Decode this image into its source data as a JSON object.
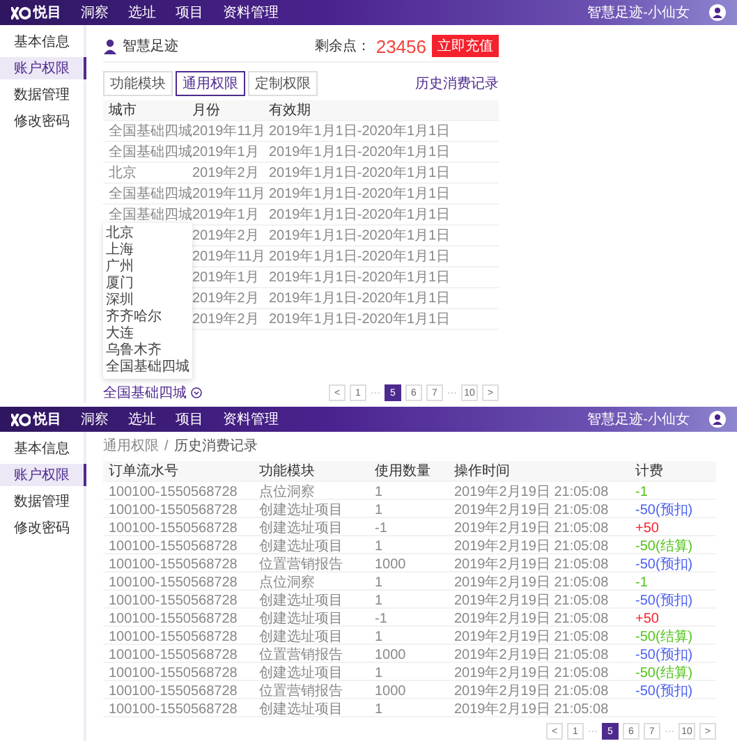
{
  "permissions_screen": {
    "header": {
      "logo": "悦目",
      "nav": [
        "洞察",
        "选址",
        "项目",
        "资料管理"
      ],
      "user": "智慧足迹-小仙女"
    },
    "sidebar": [
      {
        "label": "基本信息",
        "selected": false
      },
      {
        "label": "账户权限",
        "selected": true
      },
      {
        "label": "数据管理",
        "selected": false
      },
      {
        "label": "修改密码",
        "selected": false
      }
    ],
    "profile": {
      "name": "智慧足迹",
      "points_label": "剩余点：",
      "points": "23456",
      "recharge_button": "立即充值"
    },
    "tabs": [
      {
        "label": "功能模块",
        "selected": false
      },
      {
        "label": "通用权限",
        "selected": true
      },
      {
        "label": "定制权限",
        "selected": false
      }
    ],
    "history_link": "历史消费记录",
    "table": {
      "columns": [
        "城市",
        "月份",
        "有效期"
      ],
      "rows": [
        {
          "city": "全国基础四城",
          "month": "2019年11月",
          "validity": "2019年1月1日-2020年1月1日"
        },
        {
          "city": "全国基础四城",
          "month": "2019年1月",
          "validity": "2019年1月1日-2020年1月1日"
        },
        {
          "city": "北京",
          "month": "2019年2月",
          "validity": "2019年1月1日-2020年1月1日"
        },
        {
          "city": "全国基础四城",
          "month": "2019年11月",
          "validity": "2019年1月1日-2020年1月1日"
        },
        {
          "city": "全国基础四城",
          "month": "2019年1月",
          "validity": "2019年1月1日-2020年1月1日"
        },
        {
          "month": "2019年2月",
          "validity": "2019年1月1日-2020年1月1日"
        },
        {
          "month": "2019年11月",
          "validity": "2019年1月1日-2020年1月1日"
        },
        {
          "month": "2019年1月",
          "validity": "2019年1月1日-2020年1月1日"
        },
        {
          "month": "2019年2月",
          "validity": "2019年1月1日-2020年1月1日"
        },
        {
          "month": "2019年2月",
          "validity": "2019年1月1日-2020年1月1日"
        }
      ]
    },
    "city_select": {
      "value": "全国基础四城",
      "expanded": true,
      "options": [
        "北京",
        "上海",
        "广州",
        "厦门",
        "深圳",
        "齐齐哈尔",
        "大连",
        "乌鲁木齐",
        "全国基础四城"
      ]
    },
    "pagination": [
      {
        "label": "<",
        "kind": "page",
        "selected": false
      },
      {
        "label": "1",
        "kind": "page",
        "selected": false
      },
      {
        "label": "···",
        "kind": "ellipsis",
        "selected": false
      },
      {
        "label": "5",
        "kind": "page",
        "selected": true
      },
      {
        "label": "6",
        "kind": "page",
        "selected": false
      },
      {
        "label": "7",
        "kind": "page",
        "selected": false
      },
      {
        "label": "···",
        "kind": "ellipsis",
        "selected": false
      },
      {
        "label": "10",
        "kind": "page",
        "selected": false
      },
      {
        "label": ">",
        "kind": "page",
        "selected": false
      }
    ]
  },
  "history_screen": {
    "header": {
      "logo": "悦目",
      "nav": [
        "洞察",
        "选址",
        "项目",
        "资料管理"
      ],
      "user": "智慧足迹-小仙女"
    },
    "sidebar": [
      {
        "label": "基本信息",
        "selected": false
      },
      {
        "label": "账户权限",
        "selected": true
      },
      {
        "label": "数据管理",
        "selected": false
      },
      {
        "label": "修改密码",
        "selected": false
      }
    ],
    "breadcrumb": [
      "通用权限",
      "/",
      "历史消费记录"
    ],
    "table": {
      "columns": [
        "订单流水号",
        "功能模块",
        "使用数量",
        "操作时间",
        "计费"
      ],
      "rows": [
        {
          "order": "100100-1550568728",
          "module": "点位洞察",
          "quantity": "1",
          "time": "2019年2月19日 21:05:08",
          "fee": "-1",
          "color": "#52c41a"
        },
        {
          "order": "100100-1550568728",
          "module": "创建选址项目",
          "quantity": "1",
          "time": "2019年2月19日 21:05:08",
          "fee": "-50(预扣)",
          "color": "#4a5ff0"
        },
        {
          "order": "100100-1550568728",
          "module": "创建选址项目",
          "quantity": "-1",
          "time": "2019年2月19日 21:05:08",
          "fee": "+50",
          "color": "#f5222d"
        },
        {
          "order": "100100-1550568728",
          "module": "创建选址项目",
          "quantity": "1",
          "time": "2019年2月19日 21:05:08",
          "fee": "-50(结算)",
          "color": "#52c41a"
        },
        {
          "order": "100100-1550568728",
          "module": "位置营销报告",
          "quantity": "1000",
          "time": "2019年2月19日 21:05:08",
          "fee": "-50(预扣)",
          "color": "#4a5ff0"
        },
        {
          "order": "100100-1550568728",
          "module": "点位洞察",
          "quantity": "1",
          "time": "2019年2月19日 21:05:08",
          "fee": "-1",
          "color": "#52c41a"
        },
        {
          "order": "100100-1550568728",
          "module": "创建选址项目",
          "quantity": "1",
          "time": "2019年2月19日 21:05:08",
          "fee": "-50(预扣)",
          "color": "#4a5ff0"
        },
        {
          "order": "100100-1550568728",
          "module": "创建选址项目",
          "quantity": "-1",
          "time": "2019年2月19日 21:05:08",
          "fee": "+50",
          "color": "#f5222d"
        },
        {
          "order": "100100-1550568728",
          "module": "创建选址项目",
          "quantity": "1",
          "time": "2019年2月19日 21:05:08",
          "fee": "-50(结算)",
          "color": "#52c41a"
        },
        {
          "order": "100100-1550568728",
          "module": "位置营销报告",
          "quantity": "1000",
          "time": "2019年2月19日 21:05:08",
          "fee": "-50(预扣)",
          "color": "#4a5ff0"
        },
        {
          "order": "100100-1550568728",
          "module": "创建选址项目",
          "quantity": "1",
          "time": "2019年2月19日 21:05:08",
          "fee": "-50(结算)",
          "color": "#52c41a"
        },
        {
          "order": "100100-1550568728",
          "module": "位置营销报告",
          "quantity": "1000",
          "time": "2019年2月19日 21:05:08",
          "fee": "-50(预扣)",
          "color": "#4a5ff0"
        },
        {
          "order": "100100-1550568728",
          "module": "创建选址项目",
          "quantity": "1",
          "time": "2019年2月19日 21:05:08"
        }
      ]
    },
    "pagination": [
      {
        "label": "<",
        "kind": "page",
        "selected": false
      },
      {
        "label": "1",
        "kind": "page",
        "selected": false
      },
      {
        "label": "···",
        "kind": "ellipsis",
        "selected": false
      },
      {
        "label": "5",
        "kind": "page",
        "selected": true
      },
      {
        "label": "6",
        "kind": "page",
        "selected": false
      },
      {
        "label": "7",
        "kind": "page",
        "selected": false
      },
      {
        "label": "···",
        "kind": "ellipsis",
        "selected": false
      },
      {
        "label": "10",
        "kind": "page",
        "selected": false
      },
      {
        "label": ">",
        "kind": "page",
        "selected": false
      }
    ]
  }
}
